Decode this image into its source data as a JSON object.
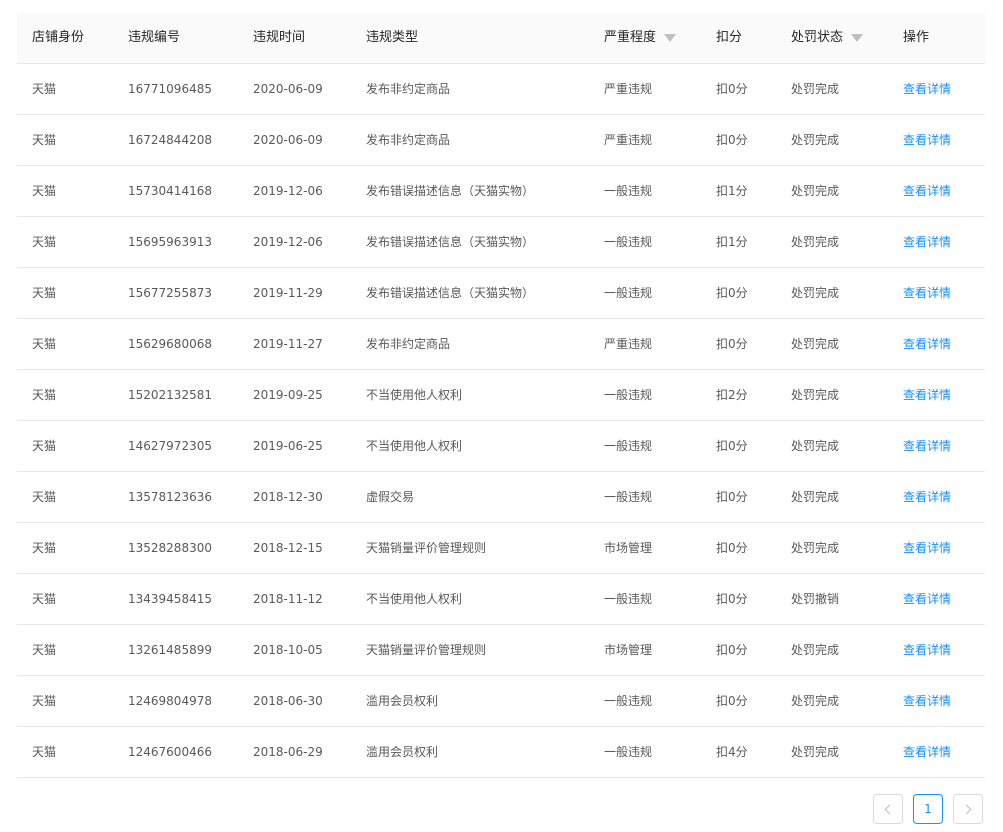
{
  "table": {
    "columns": [
      "店铺身份",
      "违规编号",
      "违规时间",
      "违规类型",
      "严重程度",
      "扣分",
      "处罚状态",
      "操作"
    ],
    "rows": [
      {
        "shop": "天猫",
        "id": "16771096485",
        "date": "2020-06-09",
        "type": "发布非约定商品",
        "severity": "严重违规",
        "points": "扣0分",
        "status": "处罚完成",
        "action": "查看详情"
      },
      {
        "shop": "天猫",
        "id": "16724844208",
        "date": "2020-06-09",
        "type": "发布非约定商品",
        "severity": "严重违规",
        "points": "扣0分",
        "status": "处罚完成",
        "action": "查看详情"
      },
      {
        "shop": "天猫",
        "id": "15730414168",
        "date": "2019-12-06",
        "type": "发布错误描述信息（天猫实物）",
        "severity": "一般违规",
        "points": "扣1分",
        "status": "处罚完成",
        "action": "查看详情"
      },
      {
        "shop": "天猫",
        "id": "15695963913",
        "date": "2019-12-06",
        "type": "发布错误描述信息（天猫实物）",
        "severity": "一般违规",
        "points": "扣1分",
        "status": "处罚完成",
        "action": "查看详情"
      },
      {
        "shop": "天猫",
        "id": "15677255873",
        "date": "2019-11-29",
        "type": "发布错误描述信息（天猫实物）",
        "severity": "一般违规",
        "points": "扣0分",
        "status": "处罚完成",
        "action": "查看详情"
      },
      {
        "shop": "天猫",
        "id": "15629680068",
        "date": "2019-11-27",
        "type": "发布非约定商品",
        "severity": "严重违规",
        "points": "扣0分",
        "status": "处罚完成",
        "action": "查看详情"
      },
      {
        "shop": "天猫",
        "id": "15202132581",
        "date": "2019-09-25",
        "type": "不当使用他人权利",
        "severity": "一般违规",
        "points": "扣2分",
        "status": "处罚完成",
        "action": "查看详情"
      },
      {
        "shop": "天猫",
        "id": "14627972305",
        "date": "2019-06-25",
        "type": "不当使用他人权利",
        "severity": "一般违规",
        "points": "扣0分",
        "status": "处罚完成",
        "action": "查看详情"
      },
      {
        "shop": "天猫",
        "id": "13578123636",
        "date": "2018-12-30",
        "type": "虚假交易",
        "severity": "一般违规",
        "points": "扣0分",
        "status": "处罚完成",
        "action": "查看详情"
      },
      {
        "shop": "天猫",
        "id": "13528288300",
        "date": "2018-12-15",
        "type": "天猫销量评价管理规则",
        "severity": "市场管理",
        "points": "扣0分",
        "status": "处罚完成",
        "action": "查看详情"
      },
      {
        "shop": "天猫",
        "id": "13439458415",
        "date": "2018-11-12",
        "type": "不当使用他人权利",
        "severity": "一般违规",
        "points": "扣0分",
        "status": "处罚撤销",
        "action": "查看详情"
      },
      {
        "shop": "天猫",
        "id": "13261485899",
        "date": "2018-10-05",
        "type": "天猫销量评价管理规则",
        "severity": "市场管理",
        "points": "扣0分",
        "status": "处罚完成",
        "action": "查看详情"
      },
      {
        "shop": "天猫",
        "id": "12469804978",
        "date": "2018-06-30",
        "type": "滥用会员权利",
        "severity": "一般违规",
        "points": "扣0分",
        "status": "处罚完成",
        "action": "查看详情"
      },
      {
        "shop": "天猫",
        "id": "12467600466",
        "date": "2018-06-29",
        "type": "滥用会员权利",
        "severity": "一般违规",
        "points": "扣4分",
        "status": "处罚完成",
        "action": "查看详情"
      }
    ]
  },
  "pagination": {
    "current_page": "1"
  },
  "colors": {
    "link": "#1890ff",
    "header_bg": "#fafafa",
    "border": "#e8e8e8"
  },
  "icons": {
    "filter": "filter-icon",
    "prev": "chevron-left-icon",
    "next": "chevron-right-icon"
  }
}
